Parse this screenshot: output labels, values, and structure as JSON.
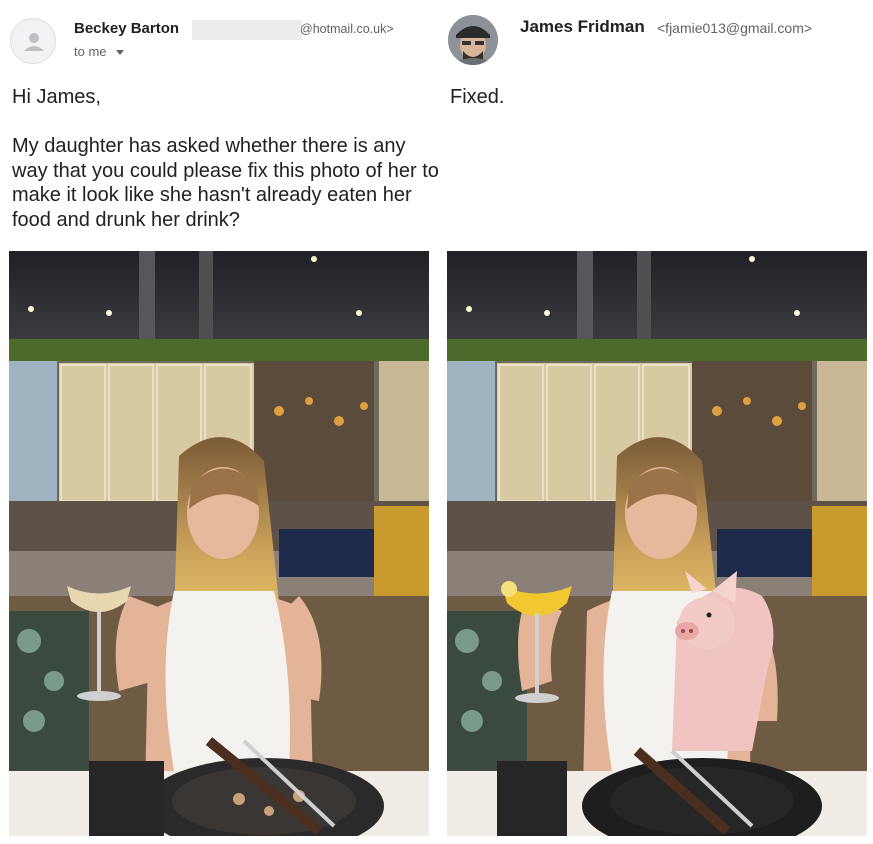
{
  "left_email": {
    "sender_name": "Beckey Barton",
    "sender_email_visible": "@hotmail.co.uk>",
    "recipient_label": "to me",
    "greeting": "Hi James,",
    "body": "My daughter has asked whether there is any way that you could please fix this photo of her to make it look like she hasn't already eaten her food and drunk her drink?"
  },
  "right_email": {
    "sender_name": "James Fridman",
    "sender_email": "<fjamie013@gmail.com>",
    "body": "Fixed."
  },
  "colors": {
    "text": "#202124",
    "secondary_text": "#5f6368"
  }
}
